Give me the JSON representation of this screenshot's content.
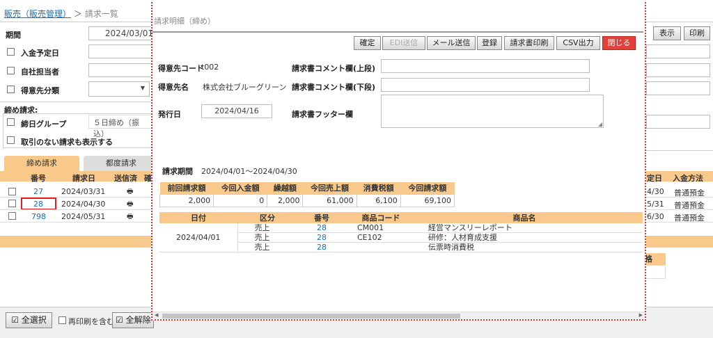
{
  "breadcrumb": {
    "link": "販売（販売管理）",
    "sep": "＞",
    "current": "請求一覧"
  },
  "filters": {
    "period_label": "期間",
    "period_value": "2024/03/01",
    "payment_due_label": "入金予定日",
    "staff_label": "自社担当者",
    "customer_class_label": "得意先分類",
    "closing_label": "締め請求:",
    "closing_group_label": "締日グループ",
    "closing_group_value": "５日締め（振込）",
    "show_no_trans_label": "取引のない請求も表示する"
  },
  "right_buttons": {
    "display": "表示",
    "print": "印刷"
  },
  "tabs": {
    "closing": "締め請求",
    "department": "都度請求"
  },
  "list": {
    "headers": [
      "番号",
      "請求日",
      "送信済",
      "確"
    ],
    "right_headers": [
      "定日",
      "入金方法"
    ],
    "rows": [
      {
        "no": "27",
        "date": "2024/03/31",
        "due": "4/30",
        "method": "普通預金"
      },
      {
        "no": "28",
        "date": "2024/04/30",
        "due": "5/31",
        "method": "普通預金"
      },
      {
        "no": "798",
        "date": "2024/05/31",
        "due": "6/30",
        "method": "普通預金"
      }
    ],
    "partial_header": "格"
  },
  "bottom": {
    "select_all": "全選択",
    "include_reprint": "再印刷を含む",
    "deselect_all": "全解除"
  },
  "modal": {
    "title": "請求明細（締め）",
    "buttons": {
      "confirm": "確定",
      "edi": "EDI送信",
      "mail": "メール送信",
      "register": "登録",
      "print_invoice": "請求書印刷",
      "csv": "CSV出力",
      "close": "閉じる"
    },
    "customer_code_label": "得意先コード",
    "customer_code": "t002",
    "customer_name_label": "得意先名",
    "customer_name": "株式会社ブルーグリーン",
    "issue_date_label": "発行日",
    "issue_date": "2024/04/16",
    "comment_top_label": "請求書コメント欄(上段)",
    "comment_bottom_label": "請求書コメント欄(下段)",
    "footer_label": "請求書フッター欄",
    "period_label": "請求期間",
    "period_value": "2024/04/01～2024/04/30",
    "summary": {
      "headers": [
        "前回請求額",
        "今回入金額",
        "繰越額",
        "今回売上額",
        "消費税額",
        "今回請求額"
      ],
      "values": [
        "2,000",
        "0",
        "2,000",
        "61,000",
        "6,100",
        "69,100"
      ]
    },
    "detail": {
      "headers": [
        "日付",
        "区分",
        "番号",
        "商品コード",
        "商品名"
      ],
      "date": "2024/04/01",
      "rows": [
        {
          "kind": "売上",
          "no": "28",
          "code": "CM001",
          "name": "経営マンスリーレポート"
        },
        {
          "kind": "売上",
          "no": "28",
          "code": "CE102",
          "name": "研修：人材育成支援"
        },
        {
          "kind": "売上",
          "no": "28",
          "code": "",
          "name": "伝票時消費税"
        }
      ]
    }
  }
}
